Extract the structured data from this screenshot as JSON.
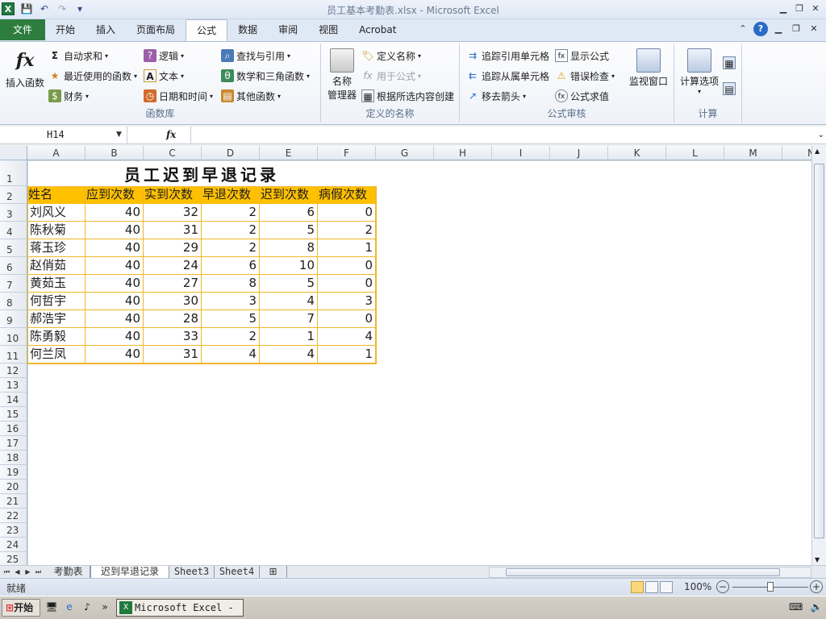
{
  "window": {
    "title": "员工基本考勤表.xlsx - Microsoft Excel",
    "app_icon": "X"
  },
  "ribbon_tabs": [
    {
      "label": "文件",
      "active": false
    },
    {
      "label": "开始",
      "active": false
    },
    {
      "label": "插入",
      "active": false
    },
    {
      "label": "页面布局",
      "active": false
    },
    {
      "label": "公式",
      "active": true
    },
    {
      "label": "数据",
      "active": false
    },
    {
      "label": "审阅",
      "active": false
    },
    {
      "label": "视图",
      "active": false
    },
    {
      "label": "Acrobat",
      "active": false
    }
  ],
  "ribbon": {
    "function_library": {
      "label": "函数库",
      "insert_function": "插入函数",
      "autosum": "自动求和",
      "recent": "最近使用的函数",
      "financial": "财务",
      "logical": "逻辑",
      "text": "文本",
      "datetime": "日期和时间",
      "lookup": "查找与引用",
      "math": "数学和三角函数",
      "more": "其他函数"
    },
    "defined_names": {
      "label": "定义的名称",
      "name_manager_1": "名称",
      "name_manager_2": "管理器",
      "define_name": "定义名称",
      "use_in_formula": "用于公式",
      "create_from_selection": "根据所选内容创建"
    },
    "formula_auditing": {
      "label": "公式审核",
      "trace_precedents": "追踪引用单元格",
      "trace_dependents": "追踪从属单元格",
      "remove_arrows": "移去箭头",
      "show_formulas": "显示公式",
      "error_checking": "错误检查",
      "evaluate_formula": "公式求值",
      "watch_window": "监视窗口"
    },
    "calculation": {
      "label": "计算",
      "calc_options": "计算选项"
    }
  },
  "formula_bar": {
    "name_box": "H14",
    "fx": "fx",
    "value": ""
  },
  "columns": [
    "A",
    "B",
    "C",
    "D",
    "E",
    "F",
    "G",
    "H",
    "I",
    "J",
    "K",
    "L",
    "M",
    "N"
  ],
  "rows": [
    "1",
    "2",
    "3",
    "4",
    "5",
    "6",
    "7",
    "8",
    "9",
    "10",
    "11",
    "12",
    "13",
    "14",
    "15",
    "16",
    "17",
    "18",
    "19",
    "20",
    "21",
    "22",
    "23",
    "24",
    "25"
  ],
  "sheet": {
    "title": "员工迟到早退记录",
    "headers": [
      "姓名",
      "应到次数",
      "实到次数",
      "早退次数",
      "迟到次数",
      "病假次数"
    ],
    "records": [
      [
        "刘风义",
        "40",
        "32",
        "2",
        "6",
        "0"
      ],
      [
        "陈秋菊",
        "40",
        "31",
        "2",
        "5",
        "2"
      ],
      [
        "蒋玉珍",
        "40",
        "29",
        "2",
        "8",
        "1"
      ],
      [
        "赵俏茹",
        "40",
        "24",
        "6",
        "10",
        "0"
      ],
      [
        "黄茹玉",
        "40",
        "27",
        "8",
        "5",
        "0"
      ],
      [
        "何哲宇",
        "40",
        "30",
        "3",
        "4",
        "3"
      ],
      [
        "郝浩宇",
        "40",
        "28",
        "5",
        "7",
        "0"
      ],
      [
        "陈勇毅",
        "40",
        "33",
        "2",
        "1",
        "4"
      ],
      [
        "何兰凤",
        "40",
        "31",
        "4",
        "4",
        "1"
      ]
    ]
  },
  "sheet_tabs": [
    {
      "label": "考勤表",
      "active": false
    },
    {
      "label": "迟到早退记录",
      "active": true
    },
    {
      "label": "Sheet3",
      "active": false
    },
    {
      "label": "Sheet4",
      "active": false
    }
  ],
  "status": {
    "ready": "就绪",
    "zoom": "100%",
    "zoom_minus": "−",
    "zoom_plus": "+"
  },
  "taskbar": {
    "start": "开始",
    "task": "Microsoft Excel - ..."
  }
}
